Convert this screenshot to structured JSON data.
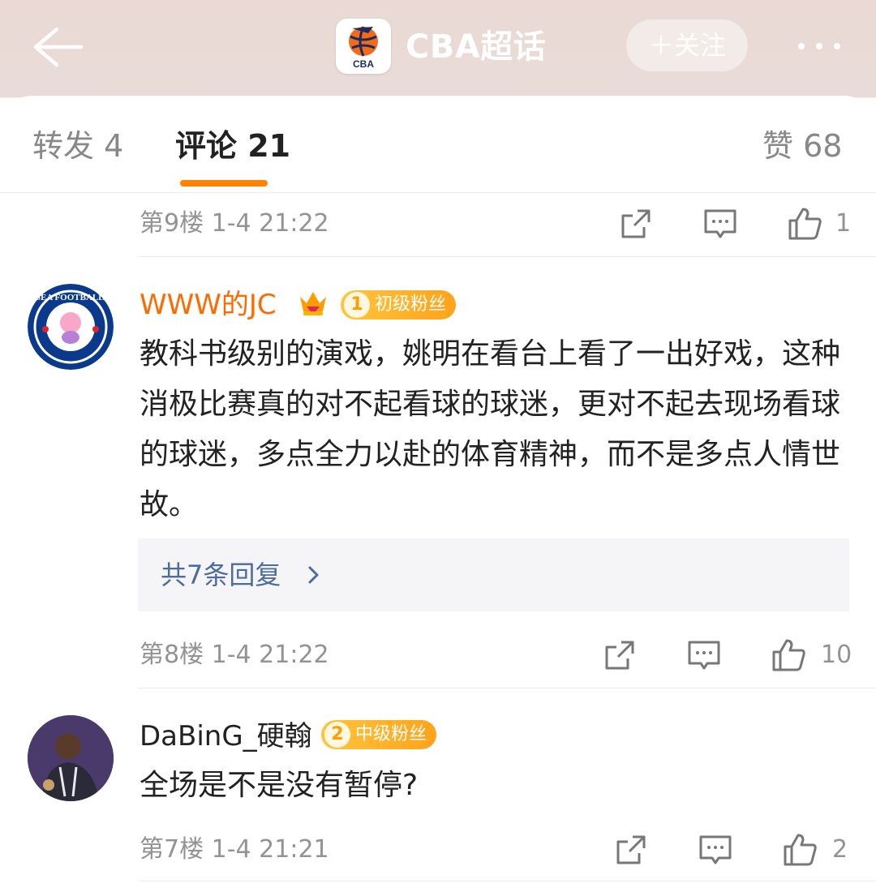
{
  "header": {
    "title": "CBA超话",
    "follow_label": "＋关注",
    "logo_text": "CBA"
  },
  "tabs": {
    "repost": "转发 4",
    "comments": "评论 21",
    "likes": "赞 68"
  },
  "floors": [
    {
      "meta": "第9楼 1-4 21:22",
      "like_count": "1"
    },
    {
      "meta": "第8楼 1-4 21:22",
      "like_count": "10"
    },
    {
      "meta": "第7楼 1-4 21:21",
      "like_count": "2"
    }
  ],
  "comments": [
    {
      "username": "WWW的JC",
      "username_color": "#ff6a00",
      "badge_level": "1",
      "badge_label": "初级粉丝",
      "avatar_text": "CHELSEA FOOTBALL CLUB",
      "text": "教科书级别的演戏，姚明在看台上看了一出好戏，这种消极比赛真的对不起看球的球迷，更对不起去现场看球的球迷，多点全力以赴的体育精神，而不是多点人情世故。",
      "replies_label": "共7条回复"
    },
    {
      "username": "DaBinG_硬翰",
      "username_color": "#222222",
      "badge_level": "2",
      "badge_label": "中级粉丝",
      "text": "全场是不是没有暂停?"
    }
  ],
  "colors": {
    "accent": "#ff8200",
    "reply_link": "#4b6c9e",
    "meta_gray": "#939393"
  },
  "icons": [
    "back-arrow-icon",
    "more-icon",
    "share-icon",
    "comment-icon",
    "like-icon",
    "crown-icon",
    "chevron-right-icon"
  ]
}
